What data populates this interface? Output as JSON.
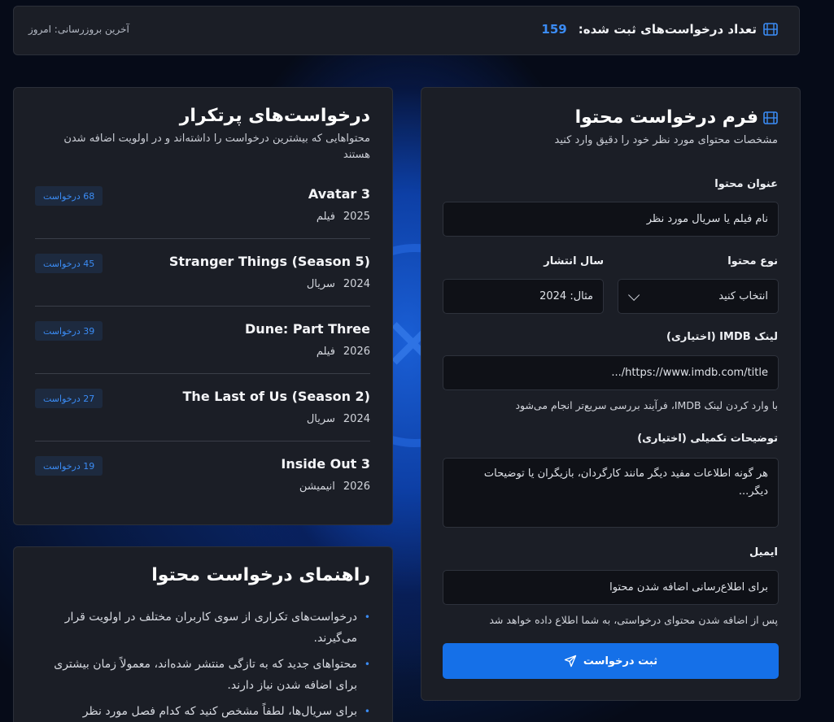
{
  "header": {
    "count_label": "تعداد درخواست‌های ثبت شده:",
    "count_value": "159",
    "last_update": "آخرین بروزرسانی: امروز"
  },
  "form": {
    "title": "فرم درخواست محتوا",
    "subtitle": "مشخصات محتوای مورد نظر خود را دقیق وارد کنید",
    "title_label": "عنوان محتوا",
    "title_placeholder": "نام فیلم یا سریال مورد نظر",
    "type_label": "نوع محتوا",
    "type_value": "انتخاب کنید",
    "year_label": "سال انتشار",
    "year_placeholder": "مثال: 2024",
    "imdb_label": "لینک IMDB (اختیاری)",
    "imdb_placeholder": "https://www.imdb.com/title/...",
    "imdb_hint": "با وارد کردن لینک IMDB، فرآیند بررسی سریع‌تر انجام می‌شود",
    "desc_label": "توضیحات تکمیلی (اختیاری)",
    "desc_placeholder": "هر گونه اطلاعات مفید دیگر مانند کارگردان، بازیگران یا توضیحات دیگر...",
    "email_label": "ایمیل",
    "email_placeholder": "برای اطلاع‌رسانی اضافه شدن محتوا",
    "email_hint": "پس از اضافه شدن محتوای درخواستی، به شما اطلاع داده خواهد شد",
    "submit_label": "ثبت درخواست",
    "icons": {
      "title": "film-icon",
      "submit": "send-icon"
    }
  },
  "popular": {
    "title": "درخواست‌های پرتکرار",
    "subtitle": "محتواهایی که بیشترین درخواست را داشته‌اند و در اولویت اضافه شدن هستند",
    "items": [
      {
        "name": "Avatar 3",
        "year": "2025",
        "type": "فیلم",
        "requests": "68 درخواست"
      },
      {
        "name": "Stranger Things (Season 5)",
        "year": "2024",
        "type": "سریال",
        "requests": "45 درخواست"
      },
      {
        "name": "Dune: Part Three",
        "year": "2026",
        "type": "فیلم",
        "requests": "39 درخواست"
      },
      {
        "name": "The Last of Us (Season 2)",
        "year": "2024",
        "type": "سریال",
        "requests": "27 درخواست"
      },
      {
        "name": "Inside Out 3",
        "year": "2026",
        "type": "انیمیشن",
        "requests": "19 درخواست"
      }
    ]
  },
  "guide": {
    "title": "راهنمای درخواست محتوا",
    "items": [
      "درخواست‌های تکراری از سوی کاربران مختلف در اولویت قرار می‌گیرند.",
      "محتواهای جدید که به تازگی منتشر شده‌اند، معمولاً زمان بیشتری برای اضافه شدن نیاز دارند.",
      "برای سریال‌ها، لطفاً مشخص کنید که کدام فصل مورد نظر"
    ]
  },
  "colors": {
    "accent": "#1570e8",
    "panel": "#1b1e26",
    "badge_text": "#3b8cf5"
  }
}
